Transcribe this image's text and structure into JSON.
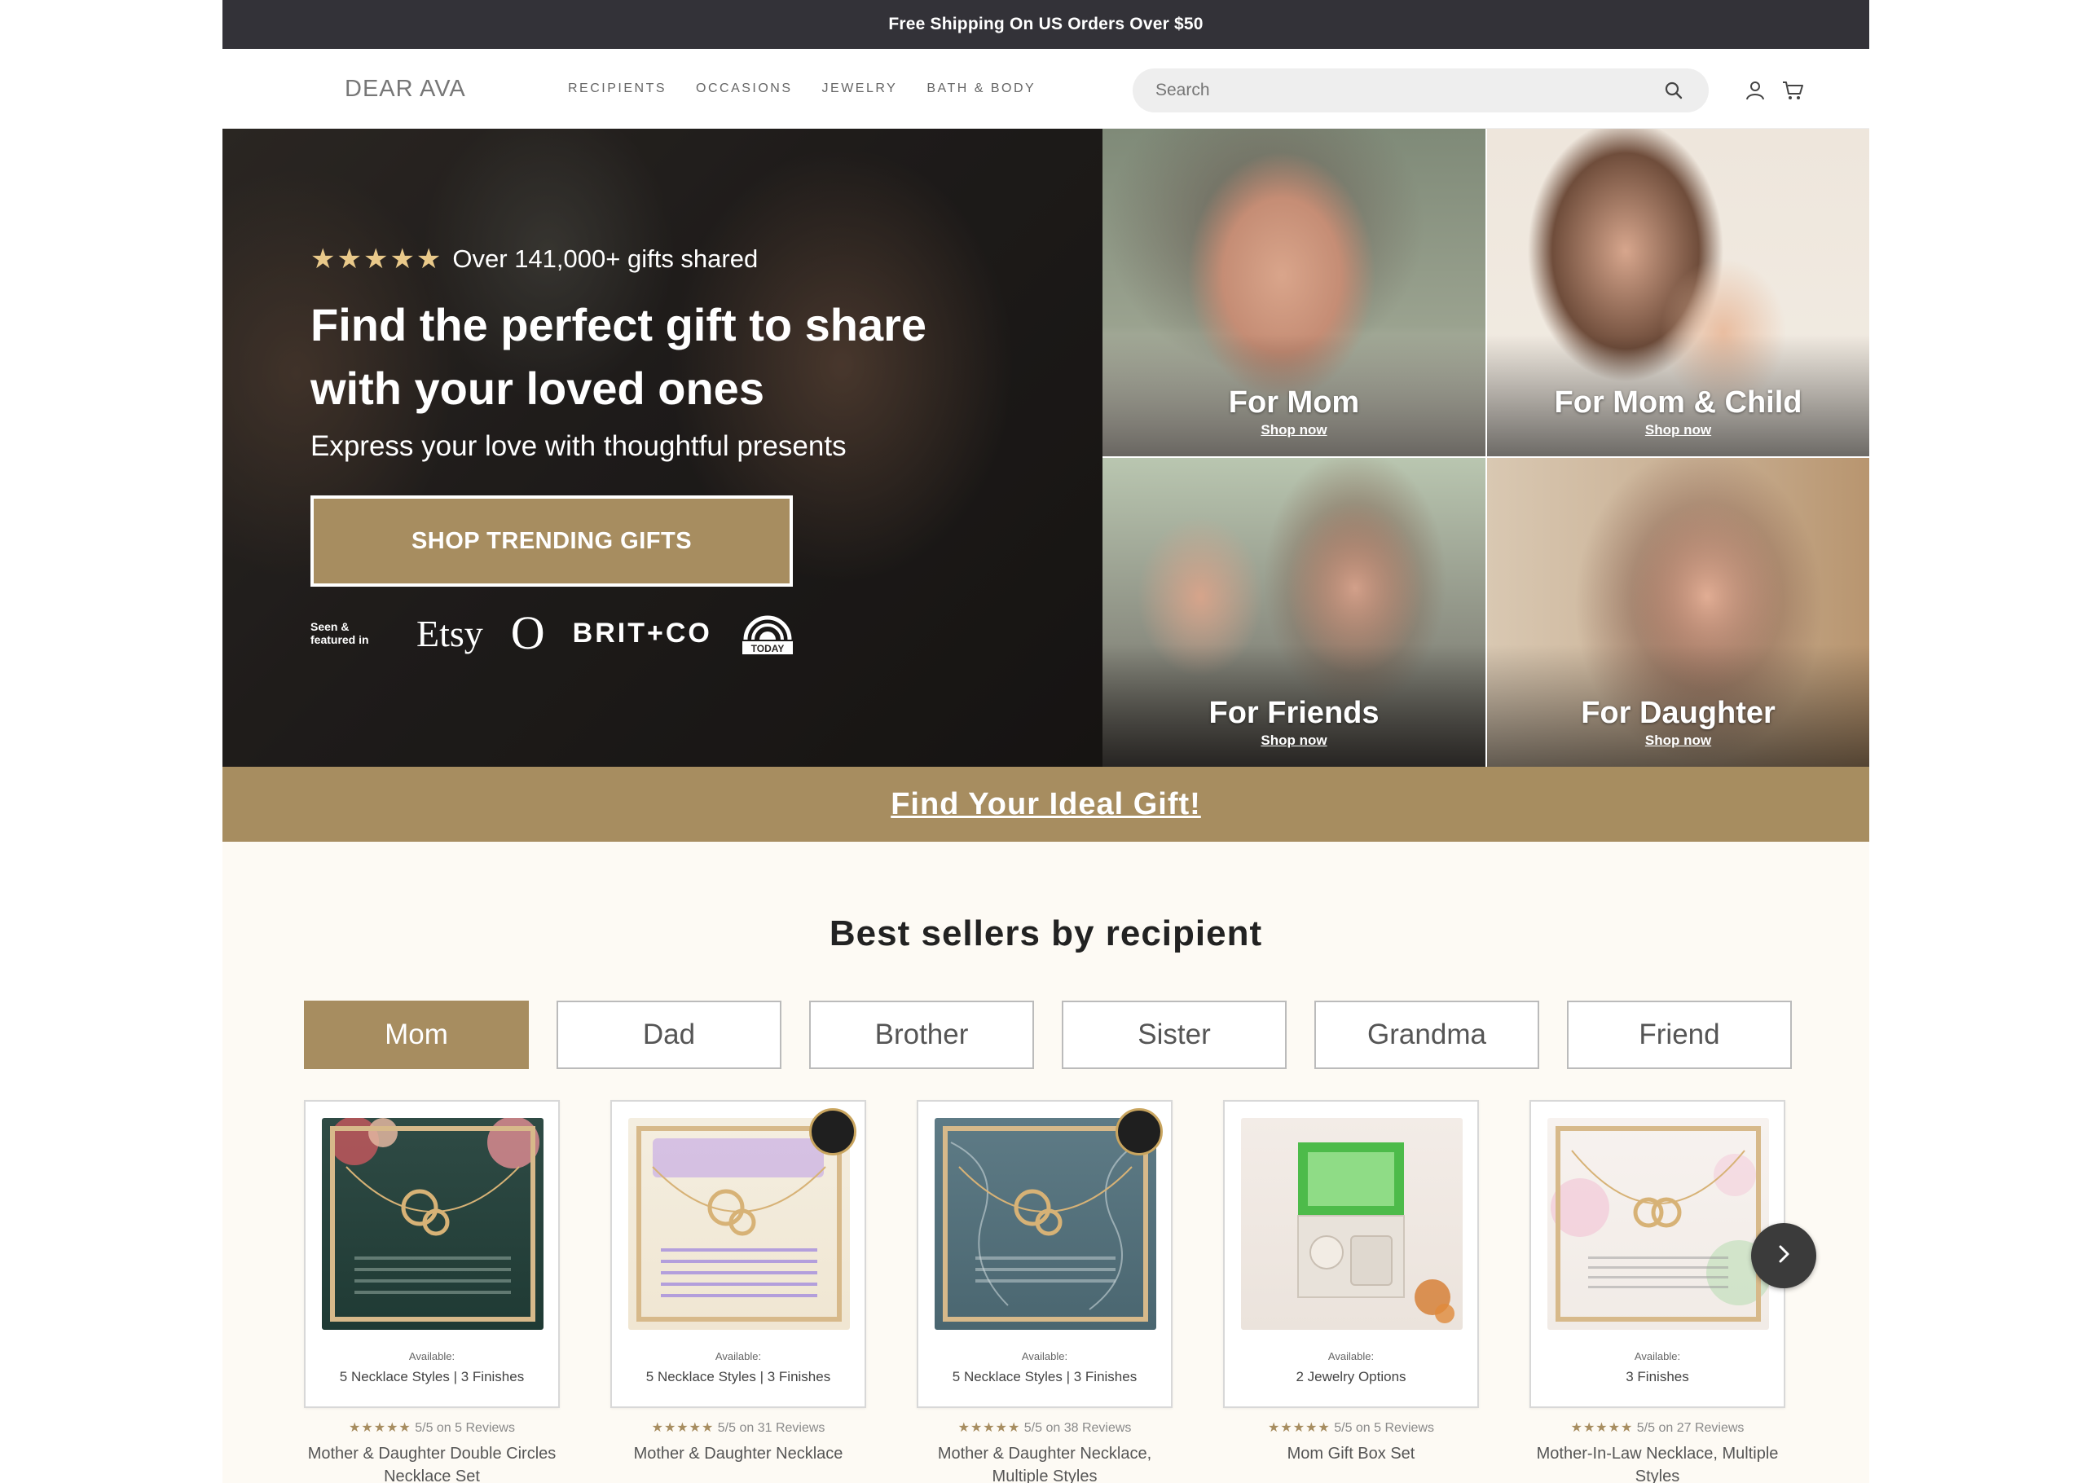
{
  "announcement": "Free Shipping On US Orders Over $50",
  "header": {
    "logo": "DEAR AVA",
    "nav": [
      "RECIPIENTS",
      "OCCASIONS",
      "JEWELRY",
      "BATH & BODY"
    ],
    "search_placeholder": "Search",
    "icons": [
      "search-icon",
      "account-icon",
      "cart-icon"
    ]
  },
  "hero": {
    "stars": "★★★★★",
    "rating_text": "Over 141,000+ gifts shared",
    "title": "Find the perfect gift to share with your loved ones",
    "subtitle": "Express your love with thoughtful presents",
    "cta": "SHOP TRENDING GIFTS",
    "featured_label": "Seen & featured in",
    "brands": [
      "Etsy",
      "O",
      "BRIT+CO",
      "TODAY"
    ]
  },
  "tiles": [
    {
      "title": "For Mom",
      "link": "Shop now"
    },
    {
      "title": "For Mom & Child",
      "link": "Shop now"
    },
    {
      "title": "For Friends",
      "link": "Shop now"
    },
    {
      "title": "For Daughter",
      "link": "Shop now"
    }
  ],
  "ideal_gift": "Find Your Ideal Gift!",
  "best_sellers": {
    "title": "Best sellers by recipient",
    "tabs": [
      "Mom",
      "Dad",
      "Brother",
      "Sister",
      "Grandma",
      "Friend"
    ],
    "active_tab": "Mom",
    "products": [
      {
        "available": "Available:",
        "options": "5 Necklace Styles | 3 Finishes",
        "stars": "★★★★★",
        "rating": "5/5 on 5 Reviews",
        "name": "Mother & Daughter Double Circles Necklace Set"
      },
      {
        "available": "Available:",
        "options": "5 Necklace Styles | 3 Finishes",
        "stars": "★★★★★",
        "rating": "5/5 on 31 Reviews",
        "name": "Mother & Daughter Necklace"
      },
      {
        "available": "Available:",
        "options": "5 Necklace Styles | 3 Finishes",
        "stars": "★★★★★",
        "rating": "5/5 on 38 Reviews",
        "name": "Mother & Daughter Necklace, Multiple Styles"
      },
      {
        "available": "Available:",
        "options": "2 Jewelry Options",
        "stars": "★★★★★",
        "rating": "5/5 on 5 Reviews",
        "name": "Mom Gift Box Set"
      },
      {
        "available": "Available:",
        "options": "3 Finishes",
        "stars": "★★★★★",
        "rating": "5/5 on 27 Reviews",
        "name": "Mother-In-Law Necklace, Multiple Styles"
      }
    ]
  },
  "colors": {
    "accent": "#a78d60",
    "announce_bg": "#333238",
    "section_bg": "#fdfaf4"
  }
}
